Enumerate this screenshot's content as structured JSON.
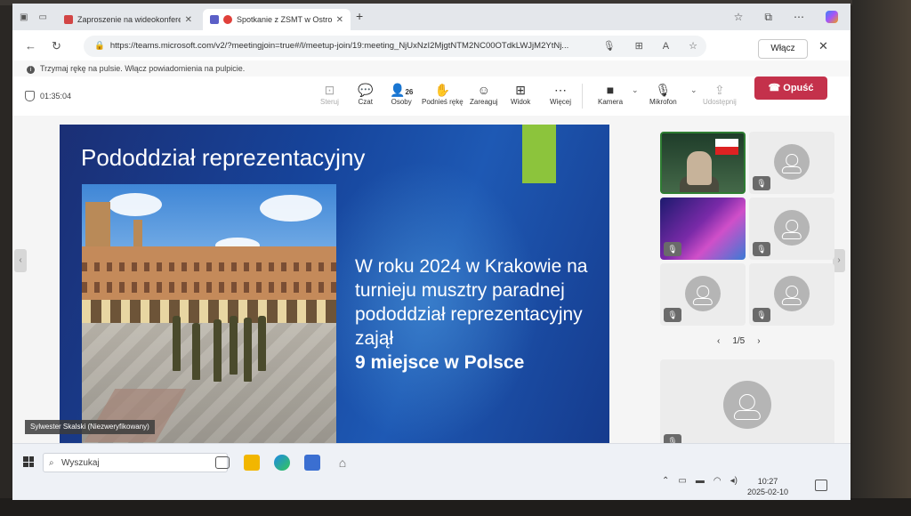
{
  "browser": {
    "tabs": [
      {
        "title": "Zaproszenie na wideokonferencję",
        "favicon_color": "#d24545"
      },
      {
        "title": "Spotkanie z ZSMT w Ostrowi",
        "favicon_color": "#e0403a"
      }
    ],
    "url": "https://teams.microsoft.com/v2/?meetingjoin=true#/l/meetup-join/19:meeting_NjUxNzI2MjgtNTM2NC00OTdkLWJjM2YtNj...",
    "enable_button": "Włącz",
    "notification": "Trzymaj rękę na pulsie. Włącz powiadomienia na pulpicie."
  },
  "meeting": {
    "timer": "01:35:04",
    "participant_count": "26",
    "toolbar": {
      "share": "Steruj",
      "chat": "Czat",
      "people": "Osoby",
      "raise_hand": "Podnieś rękę",
      "react": "Zareaguj",
      "view": "Widok",
      "more": "Więcej",
      "camera": "Kamera",
      "mic": "Mikrofon",
      "present": "Udostępnij",
      "leave": "Opuść"
    },
    "presenter_label": "Sylwester Skalski (Niezweryfikowany)",
    "pager": "1/5"
  },
  "slide": {
    "title": "Pododdział reprezentacyjny",
    "body": "W roku 2024 w Krakowie na turnieju musztry paradnej pododdział reprezentacyjny zajął",
    "highlight": "9 miejsce w Polsce",
    "accent_color": "#8cc43c"
  },
  "taskbar": {
    "search_placeholder": "Wyszukaj",
    "time": "10:27",
    "date": "2025-02-10"
  }
}
